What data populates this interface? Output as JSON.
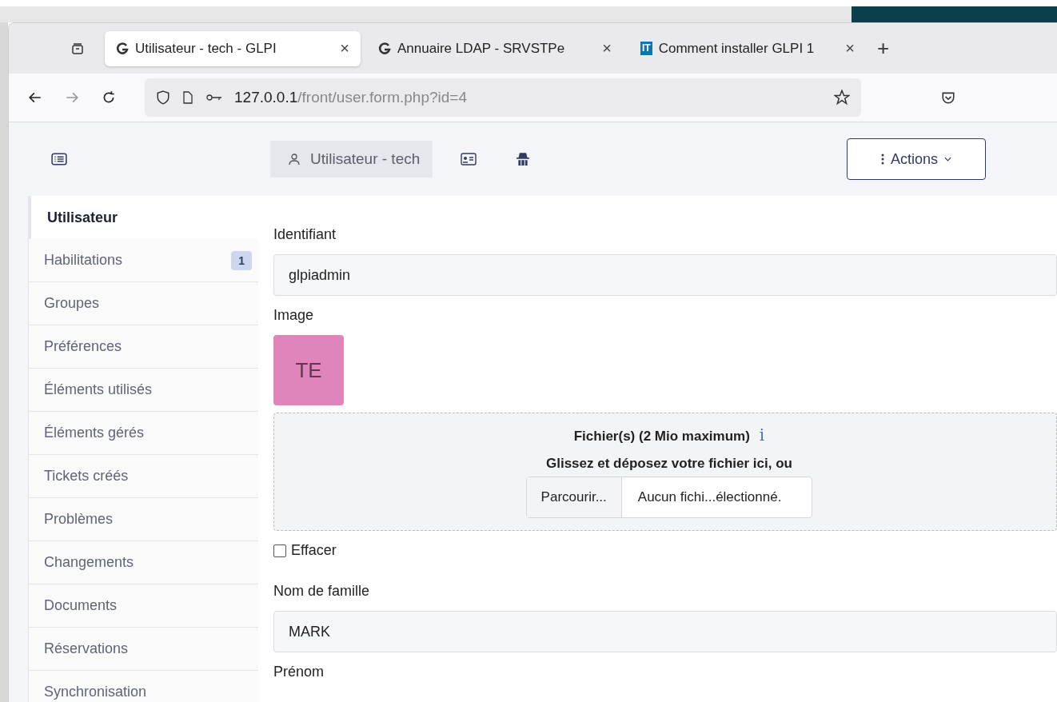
{
  "browser": {
    "tabs": [
      {
        "title": "Utilisateur - tech - GLPI",
        "kind": "logo",
        "selected": true
      },
      {
        "title": "Annuaire LDAP - SRVSTPe",
        "kind": "logo",
        "selected": false
      },
      {
        "title": "Comment installer GLPI 1",
        "kind": "text_icon",
        "icon_text": "IT",
        "selected": false
      }
    ],
    "new_tab": "+",
    "close": "×",
    "url": {
      "host": "127.0.0.1",
      "path": "/front/user.form.php?id=4"
    }
  },
  "header": {
    "title": "Utilisateur - tech",
    "actions": "Actions"
  },
  "sidebar": {
    "items": [
      {
        "label": "Utilisateur",
        "selected": true
      },
      {
        "label": "Habilitations",
        "selected": false,
        "badge": "1"
      },
      {
        "label": "Groupes",
        "selected": false
      },
      {
        "label": "Préférences",
        "selected": false
      },
      {
        "label": "Éléments utilisés",
        "selected": false
      },
      {
        "label": "Éléments gérés",
        "selected": false
      },
      {
        "label": "Tickets créés",
        "selected": false
      },
      {
        "label": "Problèmes",
        "selected": false
      },
      {
        "label": "Changements",
        "selected": false
      },
      {
        "label": "Documents",
        "selected": false
      },
      {
        "label": "Réservations",
        "selected": false
      },
      {
        "label": "Synchronisation",
        "selected": false
      }
    ]
  },
  "form": {
    "login_label": "Identifiant",
    "login_value": "glpiadmin",
    "image_label": "Image",
    "avatar_initials": "TE",
    "upload": {
      "title": "Fichier(s) (2 Mio maximum)",
      "info": "i",
      "hint": "Glissez et déposez votre fichier ici, ou",
      "browse": "Parcourir...",
      "status": "Aucun fichi...électionné."
    },
    "clear": {
      "label": "Effacer",
      "checked": false
    },
    "lastname_label": "Nom de famille",
    "lastname_value": "MARK",
    "firstname_label": "Prénom"
  }
}
